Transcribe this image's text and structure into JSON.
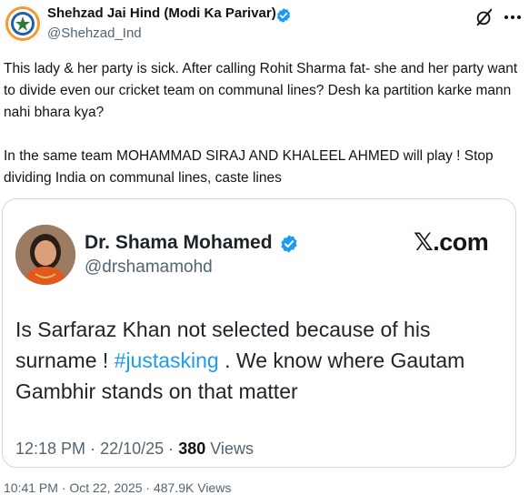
{
  "tweet": {
    "author_name": "Shehzad Jai Hind (Modi Ka Parivar)",
    "author_handle": "@Shehzad_Ind",
    "verified": true,
    "text": "This lady & her party is sick. After calling Rohit Sharma fat- she and her party want to divide even our cricket team on communal lines? Desh ka partition karke mann nahi bhara kya?\n\nIn the same team MOHAMMAD SIRAJ AND KHALEEL AHMED will play ! Stop dividing India on communal lines, caste lines",
    "footer_partial": "10:41 PM · Oct 22, 2025 · 487.9K Views"
  },
  "quoted": {
    "author_name": "Dr. Shama Mohamed",
    "author_handle": "@drshamamohd",
    "verified": true,
    "brand": "𝕏.com",
    "text_before": "Is Sarfaraz Khan not selected because of his surname ! ",
    "hashtag": "#justasking",
    "text_after": " . We know where Gautam Gambhir stands on that matter",
    "time": "12:18 PM",
    "date": "22/10/25",
    "separator": "·",
    "views_count": "380",
    "views_label": "Views"
  },
  "icons": {
    "verified": "verified-badge-icon",
    "grok": "grok-icon",
    "more": "more-options-icon"
  },
  "colors": {
    "verified_blue": "#1d9bf0",
    "hashtag_blue": "#1d9bf0",
    "secondary_text": "#536471",
    "border": "#cfd9de"
  }
}
